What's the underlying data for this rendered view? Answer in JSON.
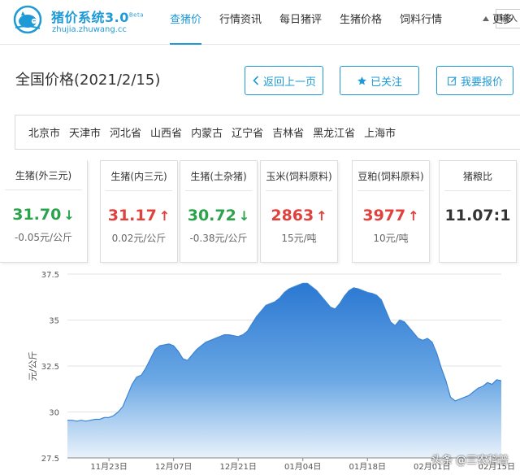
{
  "header": {
    "brand": "猪价系统3.0",
    "brand_tag": "Beta",
    "domain": "zhujia.zhuwang.cc",
    "nav": [
      {
        "label": "查猪价",
        "active": true
      },
      {
        "label": "行情资讯",
        "active": false
      },
      {
        "label": "每日猪评",
        "active": false
      },
      {
        "label": "生猪价格",
        "active": false
      },
      {
        "label": "饲料行情",
        "active": false
      }
    ],
    "search_placeholder": "输入",
    "accent_color": "#1e9ad6"
  },
  "page": {
    "title": "全国价格(2021/2/15)",
    "buttons": {
      "back": "返回上一页",
      "follow": "已关注",
      "report": "我要报价"
    }
  },
  "regions": [
    "北京市",
    "天津市",
    "河北省",
    "山西省",
    "内蒙古",
    "辽宁省",
    "吉林省",
    "黑龙江省",
    "上海市"
  ],
  "more_label": "更多",
  "cards": [
    {
      "name": "生猪(外三元)",
      "price": "31.70",
      "trend": "down",
      "arrow": "↓",
      "change": "-0.05元/公斤"
    },
    {
      "name": "生猪(内三元)",
      "price": "31.17",
      "trend": "up",
      "arrow": "↑",
      "change": "0.02元/公斤"
    },
    {
      "name": "生猪(土杂猪)",
      "price": "30.72",
      "trend": "down",
      "arrow": "↓",
      "change": "-0.38元/公斤"
    },
    {
      "name": "玉米(饲料原料)",
      "price": "2863",
      "trend": "up",
      "arrow": "↑",
      "change": "15元/吨"
    },
    {
      "name": "豆粕(饲料原料)",
      "price": "3977",
      "trend": "up",
      "arrow": "↑",
      "change": "10元/吨"
    },
    {
      "name": "猪粮比",
      "price": "11.07:1",
      "trend": "flat",
      "arrow": "",
      "change": ""
    }
  ],
  "colors": {
    "up": "#e1413d",
    "down": "#2ba24c",
    "area_top": "#2a78d2",
    "area_bottom": "#e9f2fb"
  },
  "watermark": "头条 @三农科普",
  "chart_data": {
    "type": "area",
    "title": "",
    "xlabel": "",
    "ylabel": "元/公斤",
    "ylim": [
      27.5,
      37.5
    ],
    "yticks": [
      27.5,
      30,
      32.5,
      35,
      37.5
    ],
    "xtick_labels": [
      "11月23日",
      "12月07日",
      "12月21日",
      "01月04日",
      "01月18日",
      "02月01日",
      "02月15日"
    ],
    "xtick_index": [
      9,
      23,
      37,
      51,
      65,
      79,
      93
    ],
    "grid": true,
    "legend": "none",
    "series": [
      {
        "values": [
          29.55,
          29.55,
          29.5,
          29.55,
          29.5,
          29.55,
          29.6,
          29.6,
          29.7,
          29.7,
          29.8,
          30.0,
          30.3,
          30.9,
          31.5,
          31.9,
          32.0,
          32.4,
          32.9,
          33.4,
          33.6,
          33.65,
          33.7,
          33.6,
          33.3,
          32.9,
          32.8,
          33.1,
          33.4,
          33.6,
          33.8,
          33.9,
          34.0,
          34.1,
          34.2,
          34.2,
          34.15,
          34.1,
          34.2,
          34.4,
          34.8,
          35.2,
          35.5,
          35.8,
          35.9,
          36.0,
          36.2,
          36.5,
          36.7,
          36.8,
          36.9,
          37.0,
          37.0,
          36.8,
          36.6,
          36.3,
          36.0,
          35.7,
          35.6,
          35.9,
          36.3,
          36.6,
          36.75,
          36.7,
          36.6,
          36.5,
          36.45,
          36.35,
          36.1,
          35.5,
          34.9,
          34.7,
          35.0,
          34.9,
          34.6,
          34.3,
          34.0,
          33.9,
          34.0,
          33.8,
          33.2,
          32.4,
          31.7,
          30.8,
          30.6,
          30.7,
          30.8,
          30.9,
          31.1,
          31.3,
          31.4,
          31.6,
          31.5,
          31.75,
          31.7
        ]
      }
    ]
  }
}
